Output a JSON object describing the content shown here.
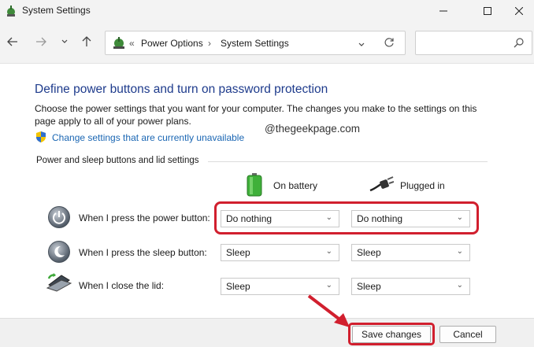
{
  "window": {
    "title": "System Settings"
  },
  "nav": {
    "breadcrumb": [
      "Power Options",
      "System Settings"
    ],
    "search_placeholder": ""
  },
  "content": {
    "heading": "Define power buttons and turn on password protection",
    "description": "Choose the power settings that you want for your computer. The changes you make to the settings on this page apply to all of your power plans.",
    "change_link": "Change settings that are currently unavailable",
    "watermark": "@thegeekpage.com",
    "section_title": "Power and sleep buttons and lid settings",
    "columns": {
      "battery": "On battery",
      "plugged": "Plugged in"
    },
    "rows": [
      {
        "label": "When I press the power button:",
        "battery": "Do nothing",
        "plugged": "Do nothing"
      },
      {
        "label": "When I press the sleep button:",
        "battery": "Sleep",
        "plugged": "Sleep"
      },
      {
        "label": "When I close the lid:",
        "battery": "Sleep",
        "plugged": "Sleep"
      }
    ]
  },
  "footer": {
    "save_label": "Save changes",
    "cancel_label": "Cancel"
  },
  "colors": {
    "heading": "#1e3b8c",
    "link": "#1a66b3",
    "highlight": "#d11f2e"
  }
}
